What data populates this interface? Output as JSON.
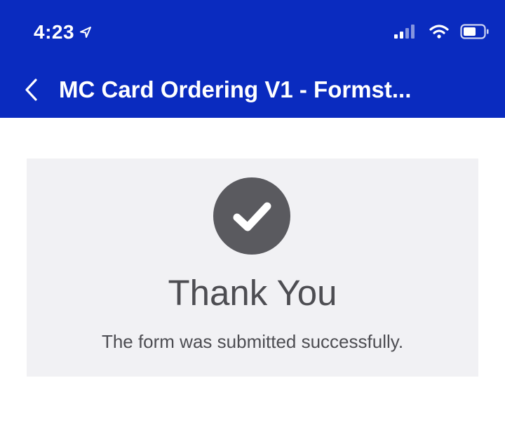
{
  "status_bar": {
    "time": "4:23",
    "icons": [
      "location-arrow-icon",
      "signal-icon",
      "wifi-icon",
      "battery-icon"
    ]
  },
  "nav_bar": {
    "back_icon": "chevron-left-icon",
    "title": "MC Card Ordering V1 - Formst..."
  },
  "confirmation": {
    "icon": "check-circle-icon",
    "heading": "Thank You",
    "message": "The form was submitted successfully."
  },
  "colors": {
    "header_background": "#0a2bbf",
    "header_text": "#ffffff",
    "card_background": "#f1f1f4",
    "icon_circle": "#5a5a5f",
    "text": "#4d4d52",
    "page_background": "#ffffff"
  }
}
